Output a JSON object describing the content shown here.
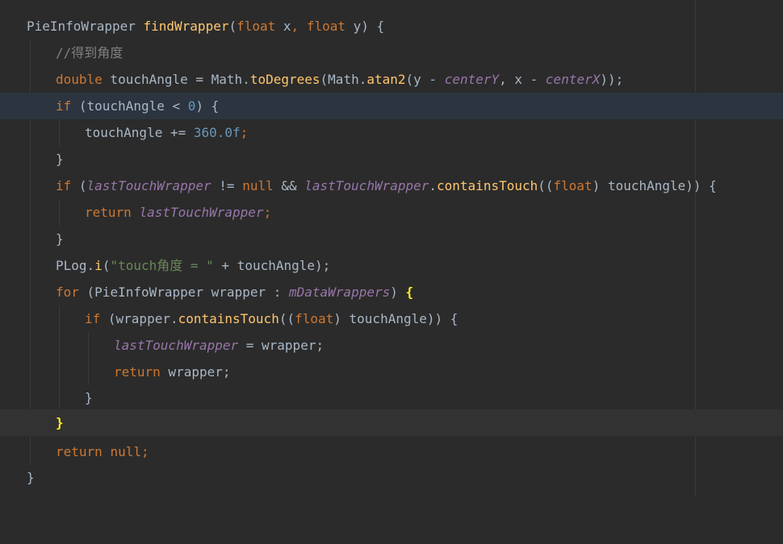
{
  "code": {
    "l1": {
      "type": "PieInfoWrapper",
      "name": "findWrapper",
      "p1": "(",
      "t1": "float",
      "a1": " x",
      "sep": ", ",
      "t2": "float",
      "a2": " y",
      "p2": ") {"
    },
    "l2": {
      "comment": "//得到角度"
    },
    "l3": {
      "type": "double",
      "var": " touchAngle = ",
      "cls": "Math.",
      "m1": "toDegrees",
      "p1": "(",
      "cls2": "Math.",
      "m2": "atan2",
      "p2": "(y - ",
      "f1": "centerY",
      "sep": ", x - ",
      "f2": "centerX",
      "p3": "));"
    },
    "l4": {
      "kw": "if",
      "open": " (touchAngle < ",
      "num": "0",
      "close": ") {"
    },
    "l5": {
      "var": "touchAngle += ",
      "num": "360.0f",
      "end": ";"
    },
    "l6": {
      "brace": "}"
    },
    "l7": {
      "kw": "if",
      "p1": " (",
      "f1": "lastTouchWrapper",
      "op": " != ",
      "nul": "null",
      "and": " && ",
      "f2": "lastTouchWrapper",
      "dot": ".",
      "m": "containsTouch",
      "p2": "((",
      "t": "float",
      "p3": ") touchAngle)) {"
    },
    "l8": {
      "kw": "return",
      "sp": " ",
      "f": "lastTouchWrapper",
      "end": ";"
    },
    "l9": {
      "brace": "}"
    },
    "l10": {
      "cls": "PLog.",
      "m": "i",
      "p1": "(",
      "str": "\"touch角度 = \"",
      "rest": " + touchAngle);"
    },
    "l11": {
      "kw": "for",
      "p1": " (",
      "type": "PieInfoWrapper",
      "v": " wrapper : ",
      "f": "mDataWrappers",
      "p2": ") ",
      "brace": "{"
    },
    "l12": {
      "kw": "if",
      "p1": " (wrapper.",
      "m": "containsTouch",
      "p2": "((",
      "t": "float",
      "p3": ") touchAngle)) {"
    },
    "l13": {
      "f": "lastTouchWrapper",
      "rest": " = wrapper;"
    },
    "l14": {
      "kw": "return",
      "rest": " wrapper;"
    },
    "l15": {
      "brace": "}"
    },
    "l16": {
      "brace": "}"
    },
    "l17": {
      "kw": "return",
      "sp": " ",
      "nul": "null",
      "end": ";"
    },
    "l18": {
      "brace": "}"
    }
  },
  "colors": {
    "background": "#2b2b2b",
    "keyword": "#cc7832",
    "method": "#ffc66d",
    "number": "#6897bb",
    "string": "#6a8759",
    "comment": "#808080",
    "field": "#9876aa",
    "text": "#a9b7c6",
    "matched_brace": "#ffef28"
  }
}
